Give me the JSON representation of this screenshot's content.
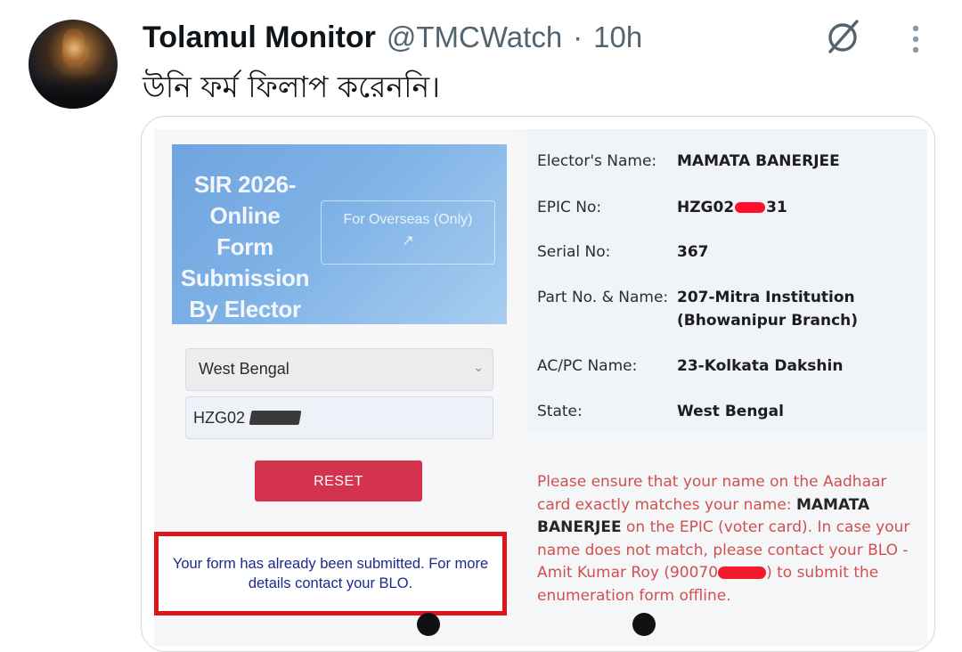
{
  "tweet": {
    "display_name": "Tolamul Monitor",
    "handle": "@TMCWatch",
    "separator": "·",
    "time": "10h",
    "text": "উনি ফর্ম ফিলাপ করেননি।",
    "icons": {
      "grok": "grok-icon",
      "more": "more-vertical-icon"
    }
  },
  "form": {
    "banner_title": "SIR 2026- Online Form Submission By Elector",
    "overseas_label": "For Overseas (Only)",
    "overseas_arrow": "↗",
    "state_select": "West Bengal",
    "epic_input": "HZG02",
    "reset_label": "RESET",
    "submitted_message": "Your form has already been submitted. For more details contact your BLO."
  },
  "elector": {
    "name_label": "Elector's Name:",
    "name": "MAMATA BANERJEE",
    "epic_label": "EPIC No:",
    "epic_prefix": "HZG02",
    "epic_suffix": "31",
    "serial_label": "Serial No:",
    "serial": "367",
    "part_label": "Part No. & Name:",
    "part_line1": "207-Mitra Institution",
    "part_line2": "(Bhowanipur Branch)",
    "acpc_label": "AC/PC Name:",
    "acpc": "23-Kolkata Dakshin",
    "state_label": "State:",
    "state": "West Bengal"
  },
  "notice": {
    "part1": "Please ensure that your name on the Aadhaar card exactly matches your name: ",
    "name": "MAMATA BANERJEE",
    "part2": " on the EPIC (voter card). In case your name does not match, please contact your BLO - Amit Kumar Roy (90070",
    "part3": ") to submit the enumeration form offline."
  },
  "colors": {
    "reset": "#d4334d",
    "highlight_border": "#e0151b",
    "notice_text": "#d05050"
  }
}
